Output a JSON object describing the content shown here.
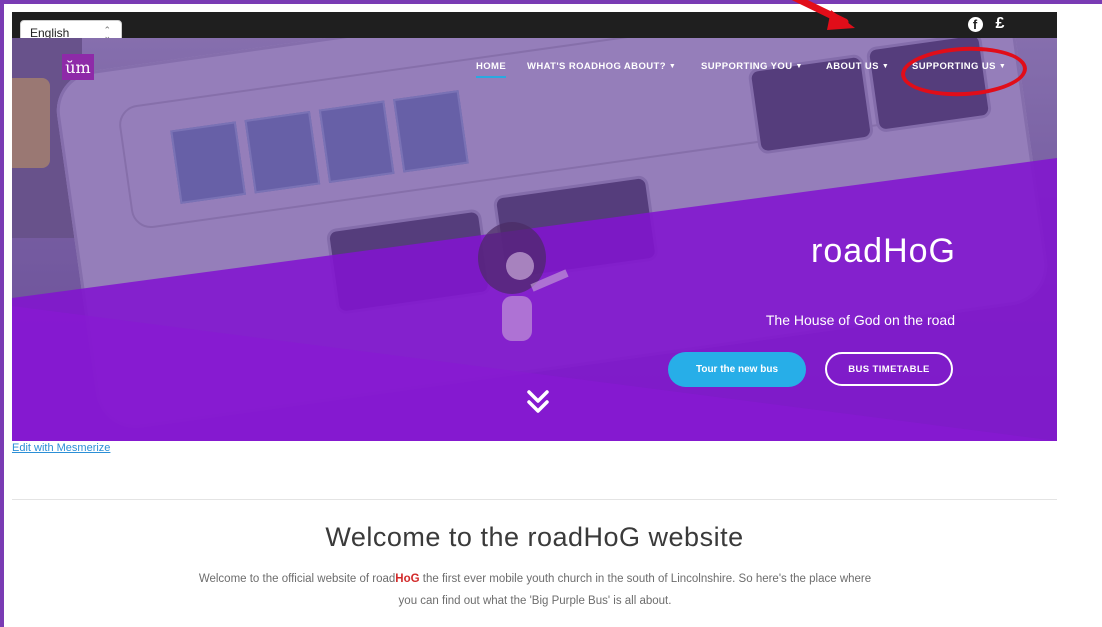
{
  "language_select": {
    "value": "English"
  },
  "social": {
    "facebook_icon": "facebook-icon",
    "donate_symbol": "£"
  },
  "nav": {
    "home": "HOME",
    "whats_roadhog_about": "WHAT'S ROADHOG ABOUT?",
    "supporting_you": "SUPPORTING YOU",
    "about_us": "ABOUT US",
    "supporting_us": "SUPPORTING US"
  },
  "hero": {
    "title": "roadHoG",
    "subtitle": "The House of God on the road",
    "primary_button": "Tour the new bus",
    "secondary_button": "BUS TIMETABLE"
  },
  "edit_link": "Edit with Mesmerize",
  "welcome": {
    "title": "Welcome to the roadHoG website",
    "text_before": "Welcome to the official website of road",
    "text_highlight": "HoG",
    "text_after": " the first ever mobile youth church in the south of Lincolnshire. So here's the place where you can find out what the 'Big Purple Bus' is all about."
  },
  "colors": {
    "accent_purple": "#8215cf",
    "button_blue": "#27aee8",
    "annotation_red": "#e10d19",
    "topbar": "#1f1f1f"
  }
}
